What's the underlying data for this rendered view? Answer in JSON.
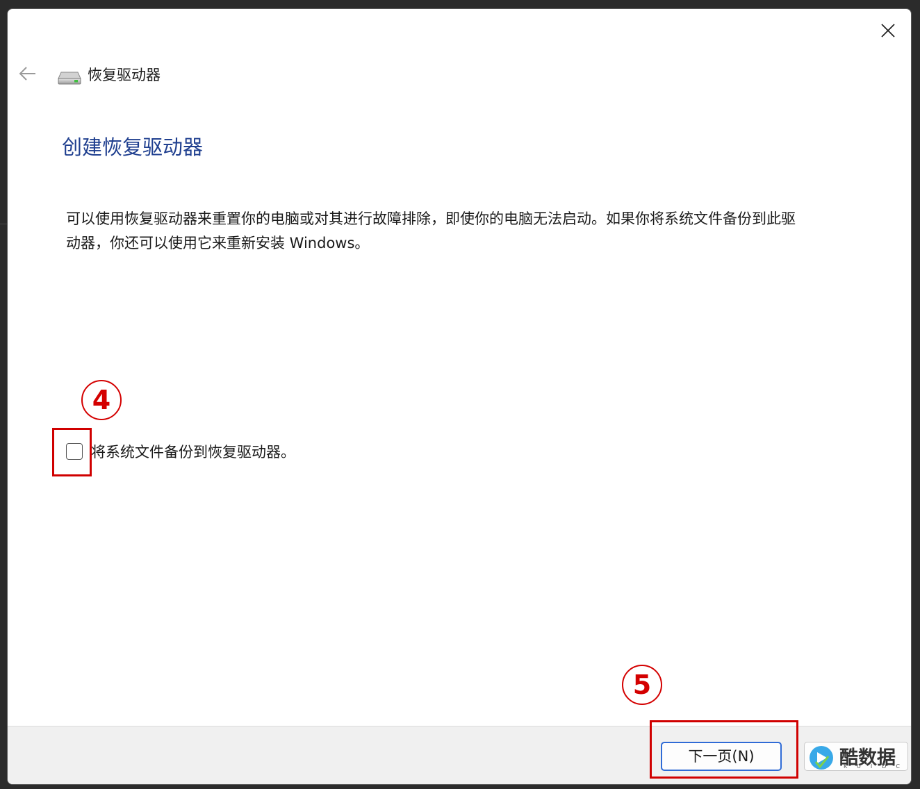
{
  "window": {
    "nav_title": "恢复驱动器",
    "heading": "创建恢复驱动器",
    "description": "可以使用恢复驱动器来重置你的电脑或对其进行故障排除，即使你的电脑无法启动。如果你将系统文件备份到此驱动器，你还可以使用它来重新安装 Windows。",
    "checkbox": {
      "label": "将系统文件备份到恢复驱动器。",
      "checked": false
    }
  },
  "annotations": {
    "step4": "4",
    "step5": "5"
  },
  "footer": {
    "next_label": "下一页(N)"
  },
  "watermark": {
    "text": "酷数据",
    "subtext": "KUIDC"
  },
  "colors": {
    "heading": "#1f3f8f",
    "annotation": "#d40000",
    "accent_border": "#2f6bd6"
  },
  "icons": {
    "close": "close-icon",
    "back": "arrow-left-icon",
    "drive": "drive-icon"
  }
}
